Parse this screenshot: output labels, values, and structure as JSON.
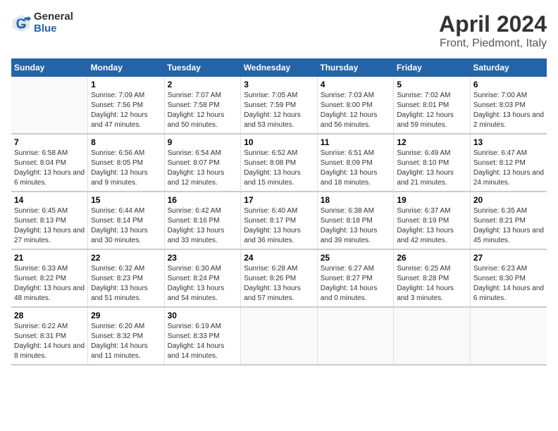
{
  "logo": {
    "general": "General",
    "blue": "Blue"
  },
  "header": {
    "title": "April 2024",
    "subtitle": "Front, Piedmont, Italy"
  },
  "days_of_week": [
    "Sunday",
    "Monday",
    "Tuesday",
    "Wednesday",
    "Thursday",
    "Friday",
    "Saturday"
  ],
  "weeks": [
    [
      {
        "num": "",
        "sunrise": "",
        "sunset": "",
        "daylight": ""
      },
      {
        "num": "1",
        "sunrise": "Sunrise: 7:09 AM",
        "sunset": "Sunset: 7:56 PM",
        "daylight": "Daylight: 12 hours and 47 minutes."
      },
      {
        "num": "2",
        "sunrise": "Sunrise: 7:07 AM",
        "sunset": "Sunset: 7:58 PM",
        "daylight": "Daylight: 12 hours and 50 minutes."
      },
      {
        "num": "3",
        "sunrise": "Sunrise: 7:05 AM",
        "sunset": "Sunset: 7:59 PM",
        "daylight": "Daylight: 12 hours and 53 minutes."
      },
      {
        "num": "4",
        "sunrise": "Sunrise: 7:03 AM",
        "sunset": "Sunset: 8:00 PM",
        "daylight": "Daylight: 12 hours and 56 minutes."
      },
      {
        "num": "5",
        "sunrise": "Sunrise: 7:02 AM",
        "sunset": "Sunset: 8:01 PM",
        "daylight": "Daylight: 12 hours and 59 minutes."
      },
      {
        "num": "6",
        "sunrise": "Sunrise: 7:00 AM",
        "sunset": "Sunset: 8:03 PM",
        "daylight": "Daylight: 13 hours and 2 minutes."
      }
    ],
    [
      {
        "num": "7",
        "sunrise": "Sunrise: 6:58 AM",
        "sunset": "Sunset: 8:04 PM",
        "daylight": "Daylight: 13 hours and 6 minutes."
      },
      {
        "num": "8",
        "sunrise": "Sunrise: 6:56 AM",
        "sunset": "Sunset: 8:05 PM",
        "daylight": "Daylight: 13 hours and 9 minutes."
      },
      {
        "num": "9",
        "sunrise": "Sunrise: 6:54 AM",
        "sunset": "Sunset: 8:07 PM",
        "daylight": "Daylight: 13 hours and 12 minutes."
      },
      {
        "num": "10",
        "sunrise": "Sunrise: 6:52 AM",
        "sunset": "Sunset: 8:08 PM",
        "daylight": "Daylight: 13 hours and 15 minutes."
      },
      {
        "num": "11",
        "sunrise": "Sunrise: 6:51 AM",
        "sunset": "Sunset: 8:09 PM",
        "daylight": "Daylight: 13 hours and 18 minutes."
      },
      {
        "num": "12",
        "sunrise": "Sunrise: 6:49 AM",
        "sunset": "Sunset: 8:10 PM",
        "daylight": "Daylight: 13 hours and 21 minutes."
      },
      {
        "num": "13",
        "sunrise": "Sunrise: 6:47 AM",
        "sunset": "Sunset: 8:12 PM",
        "daylight": "Daylight: 13 hours and 24 minutes."
      }
    ],
    [
      {
        "num": "14",
        "sunrise": "Sunrise: 6:45 AM",
        "sunset": "Sunset: 8:13 PM",
        "daylight": "Daylight: 13 hours and 27 minutes."
      },
      {
        "num": "15",
        "sunrise": "Sunrise: 6:44 AM",
        "sunset": "Sunset: 8:14 PM",
        "daylight": "Daylight: 13 hours and 30 minutes."
      },
      {
        "num": "16",
        "sunrise": "Sunrise: 6:42 AM",
        "sunset": "Sunset: 8:16 PM",
        "daylight": "Daylight: 13 hours and 33 minutes."
      },
      {
        "num": "17",
        "sunrise": "Sunrise: 6:40 AM",
        "sunset": "Sunset: 8:17 PM",
        "daylight": "Daylight: 13 hours and 36 minutes."
      },
      {
        "num": "18",
        "sunrise": "Sunrise: 6:38 AM",
        "sunset": "Sunset: 8:18 PM",
        "daylight": "Daylight: 13 hours and 39 minutes."
      },
      {
        "num": "19",
        "sunrise": "Sunrise: 6:37 AM",
        "sunset": "Sunset: 8:19 PM",
        "daylight": "Daylight: 13 hours and 42 minutes."
      },
      {
        "num": "20",
        "sunrise": "Sunrise: 6:35 AM",
        "sunset": "Sunset: 8:21 PM",
        "daylight": "Daylight: 13 hours and 45 minutes."
      }
    ],
    [
      {
        "num": "21",
        "sunrise": "Sunrise: 6:33 AM",
        "sunset": "Sunset: 8:22 PM",
        "daylight": "Daylight: 13 hours and 48 minutes."
      },
      {
        "num": "22",
        "sunrise": "Sunrise: 6:32 AM",
        "sunset": "Sunset: 8:23 PM",
        "daylight": "Daylight: 13 hours and 51 minutes."
      },
      {
        "num": "23",
        "sunrise": "Sunrise: 6:30 AM",
        "sunset": "Sunset: 8:24 PM",
        "daylight": "Daylight: 13 hours and 54 minutes."
      },
      {
        "num": "24",
        "sunrise": "Sunrise: 6:28 AM",
        "sunset": "Sunset: 8:26 PM",
        "daylight": "Daylight: 13 hours and 57 minutes."
      },
      {
        "num": "25",
        "sunrise": "Sunrise: 6:27 AM",
        "sunset": "Sunset: 8:27 PM",
        "daylight": "Daylight: 14 hours and 0 minutes."
      },
      {
        "num": "26",
        "sunrise": "Sunrise: 6:25 AM",
        "sunset": "Sunset: 8:28 PM",
        "daylight": "Daylight: 14 hours and 3 minutes."
      },
      {
        "num": "27",
        "sunrise": "Sunrise: 6:23 AM",
        "sunset": "Sunset: 8:30 PM",
        "daylight": "Daylight: 14 hours and 6 minutes."
      }
    ],
    [
      {
        "num": "28",
        "sunrise": "Sunrise: 6:22 AM",
        "sunset": "Sunset: 8:31 PM",
        "daylight": "Daylight: 14 hours and 8 minutes."
      },
      {
        "num": "29",
        "sunrise": "Sunrise: 6:20 AM",
        "sunset": "Sunset: 8:32 PM",
        "daylight": "Daylight: 14 hours and 11 minutes."
      },
      {
        "num": "30",
        "sunrise": "Sunrise: 6:19 AM",
        "sunset": "Sunset: 8:33 PM",
        "daylight": "Daylight: 14 hours and 14 minutes."
      },
      {
        "num": "",
        "sunrise": "",
        "sunset": "",
        "daylight": ""
      },
      {
        "num": "",
        "sunrise": "",
        "sunset": "",
        "daylight": ""
      },
      {
        "num": "",
        "sunrise": "",
        "sunset": "",
        "daylight": ""
      },
      {
        "num": "",
        "sunrise": "",
        "sunset": "",
        "daylight": ""
      }
    ]
  ]
}
